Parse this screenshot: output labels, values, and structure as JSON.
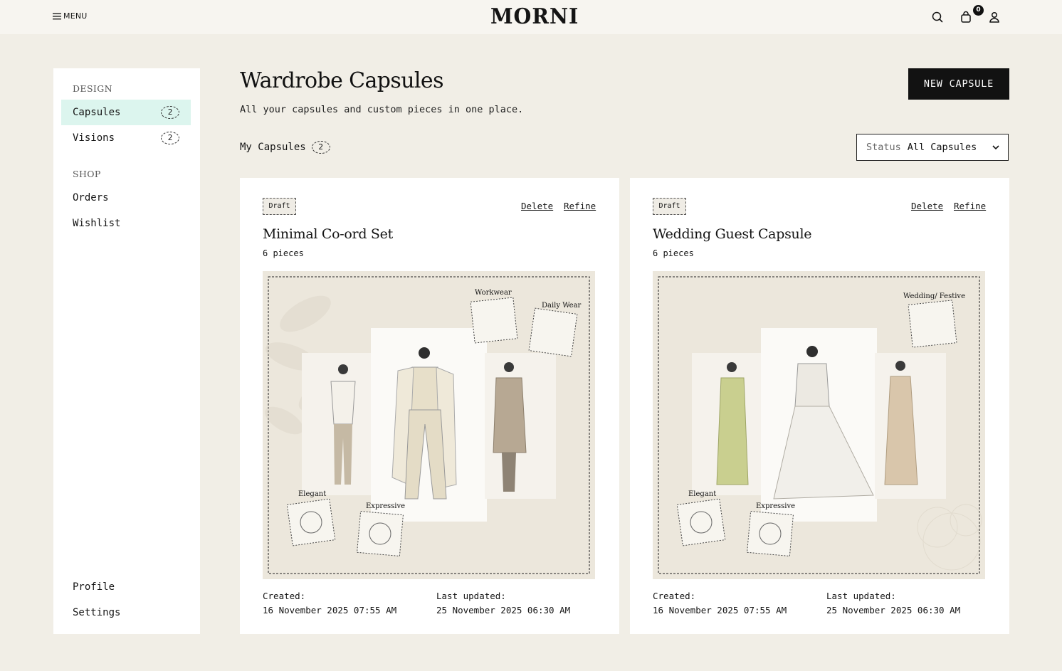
{
  "header": {
    "menu_label": "MENU",
    "logo": "MORNI",
    "cart_count": "0",
    "icons": [
      "menu-icon",
      "search-icon",
      "bag-icon",
      "user-icon"
    ]
  },
  "sidebar": {
    "design_section": "DESIGN",
    "design_items": [
      {
        "label": "Capsules",
        "count": "2",
        "active": true
      },
      {
        "label": "Visions",
        "count": "2",
        "active": false
      }
    ],
    "shop_section": "SHOP",
    "shop_items": [
      {
        "label": "Orders"
      },
      {
        "label": "Wishlist"
      }
    ],
    "bottom_items": [
      {
        "label": "Profile"
      },
      {
        "label": "Settings"
      }
    ]
  },
  "main": {
    "title": "Wardrobe Capsules",
    "subtitle": "All your capsules and custom pieces in one place.",
    "new_button": "NEW CAPSULE",
    "my_capsules_label": "My Capsules",
    "my_capsules_count": "2",
    "status_label": "Status",
    "status_value": "All Capsules"
  },
  "capsules": [
    {
      "badge": "Draft",
      "delete_label": "Delete",
      "refine_label": "Refine",
      "title": "Minimal Co-ord Set",
      "pieces": "6 pieces",
      "stickers": [
        "Workwear",
        "Daily Wear",
        "Elegant",
        "Expressive"
      ],
      "created_label": "Created:",
      "created_value": "16 November 2025 07:55 AM",
      "updated_label": "Last updated:",
      "updated_value": "25 November 2025 06:30 AM"
    },
    {
      "badge": "Draft",
      "delete_label": "Delete",
      "refine_label": "Refine",
      "title": "Wedding Guest Capsule",
      "pieces": "6 pieces",
      "stickers": [
        "Wedding/ Festive",
        "Elegant",
        "Expressive"
      ],
      "created_label": "Created:",
      "created_value": "16 November 2025 07:55 AM",
      "updated_label": "Last updated:",
      "updated_value": "25 November 2025 06:30 AM"
    }
  ],
  "colors": {
    "background": "#f1eee6",
    "active_nav": "#dcf5ee",
    "button": "#121212",
    "card_image_bg": "#ece7dc"
  }
}
